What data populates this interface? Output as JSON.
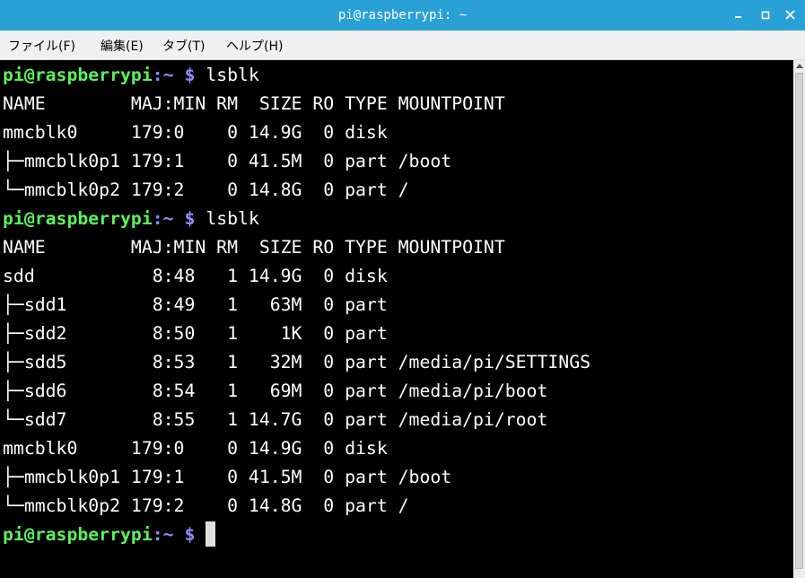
{
  "window": {
    "title": "pi@raspberrypi: ~"
  },
  "icons": {
    "minimize": "minimize-icon",
    "maximize": "maximize-icon",
    "close": "close-icon"
  },
  "menu": [
    {
      "label": "ファイル(F)"
    },
    {
      "label": "編集(E)"
    },
    {
      "label": "タブ(T)"
    },
    {
      "label": "ヘルプ(H)"
    }
  ],
  "prompt": {
    "user": "pi@raspberrypi",
    "path": ":~",
    "dollar": "$"
  },
  "colors": {
    "titlebar": "#2aa1d6",
    "prompt_user": "#5af35a",
    "prompt_path": "#8a8fff",
    "background": "#000000",
    "text": "#ffffff"
  },
  "lines": [
    {
      "type": "prompt",
      "command": " lsblk"
    },
    {
      "type": "output",
      "text": "NAME        MAJ:MIN RM  SIZE RO TYPE MOUNTPOINT"
    },
    {
      "type": "output",
      "text": "mmcblk0     179:0    0 14.9G  0 disk"
    },
    {
      "type": "output",
      "text": "├─mmcblk0p1 179:1    0 41.5M  0 part /boot"
    },
    {
      "type": "output",
      "text": "└─mmcblk0p2 179:2    0 14.8G  0 part /"
    },
    {
      "type": "prompt",
      "command": " lsblk"
    },
    {
      "type": "output",
      "text": "NAME        MAJ:MIN RM  SIZE RO TYPE MOUNTPOINT"
    },
    {
      "type": "output",
      "text": "sdd           8:48   1 14.9G  0 disk"
    },
    {
      "type": "output",
      "text": "├─sdd1        8:49   1   63M  0 part"
    },
    {
      "type": "output",
      "text": "├─sdd2        8:50   1    1K  0 part"
    },
    {
      "type": "output",
      "text": "├─sdd5        8:53   1   32M  0 part /media/pi/SETTINGS"
    },
    {
      "type": "output",
      "text": "├─sdd6        8:54   1   69M  0 part /media/pi/boot"
    },
    {
      "type": "output",
      "text": "└─sdd7        8:55   1 14.7G  0 part /media/pi/root"
    },
    {
      "type": "output",
      "text": "mmcblk0     179:0    0 14.9G  0 disk"
    },
    {
      "type": "output",
      "text": "├─mmcblk0p1 179:1    0 41.5M  0 part /boot"
    },
    {
      "type": "output",
      "text": "└─mmcblk0p2 179:2    0 14.8G  0 part /"
    },
    {
      "type": "prompt",
      "command": " ",
      "cursor": true
    }
  ]
}
